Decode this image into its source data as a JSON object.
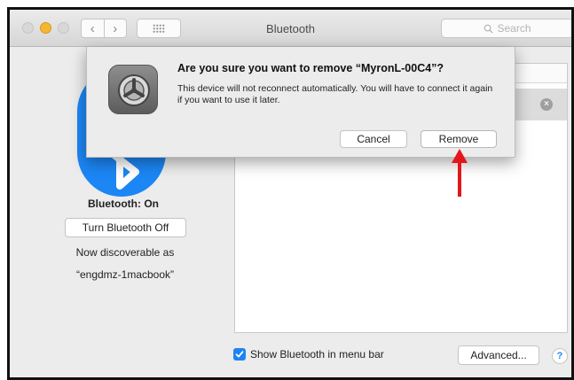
{
  "window": {
    "title": "Bluetooth",
    "search_placeholder": "Search"
  },
  "left_pane": {
    "status": "Bluetooth: On",
    "toggle_button": "Turn Bluetooth Off",
    "discoverable_label": "Now discoverable as",
    "device_name": "“engdmz-1macbook”"
  },
  "dialog": {
    "title": "Are you sure you want to remove “MyronL-00C4”?",
    "message": "This device will not reconnect automatically. You will have to connect it again if you want to use it later.",
    "cancel_label": "Cancel",
    "remove_label": "Remove"
  },
  "bottom": {
    "show_in_menu_bar_label": "Show Bluetooth in menu bar",
    "show_in_menu_bar_checked": true,
    "advanced_label": "Advanced...",
    "help_label": "?"
  },
  "icons": {
    "traffic_lights": [
      "close-icon",
      "minimize-icon",
      "zoom-icon"
    ],
    "back": "chevron-left-icon",
    "forward": "chevron-right-icon",
    "grid": "grid-icon",
    "search": "search-icon",
    "bluetooth": "bluetooth-icon",
    "preferences": "gear-icon",
    "remove_device": "remove-circle-icon",
    "annotation": "red-arrow-icon"
  },
  "colors": {
    "accent_blue": "#1c86f5",
    "minimize_yellow": "#f5b632",
    "annotation_red": "#e3161b"
  }
}
